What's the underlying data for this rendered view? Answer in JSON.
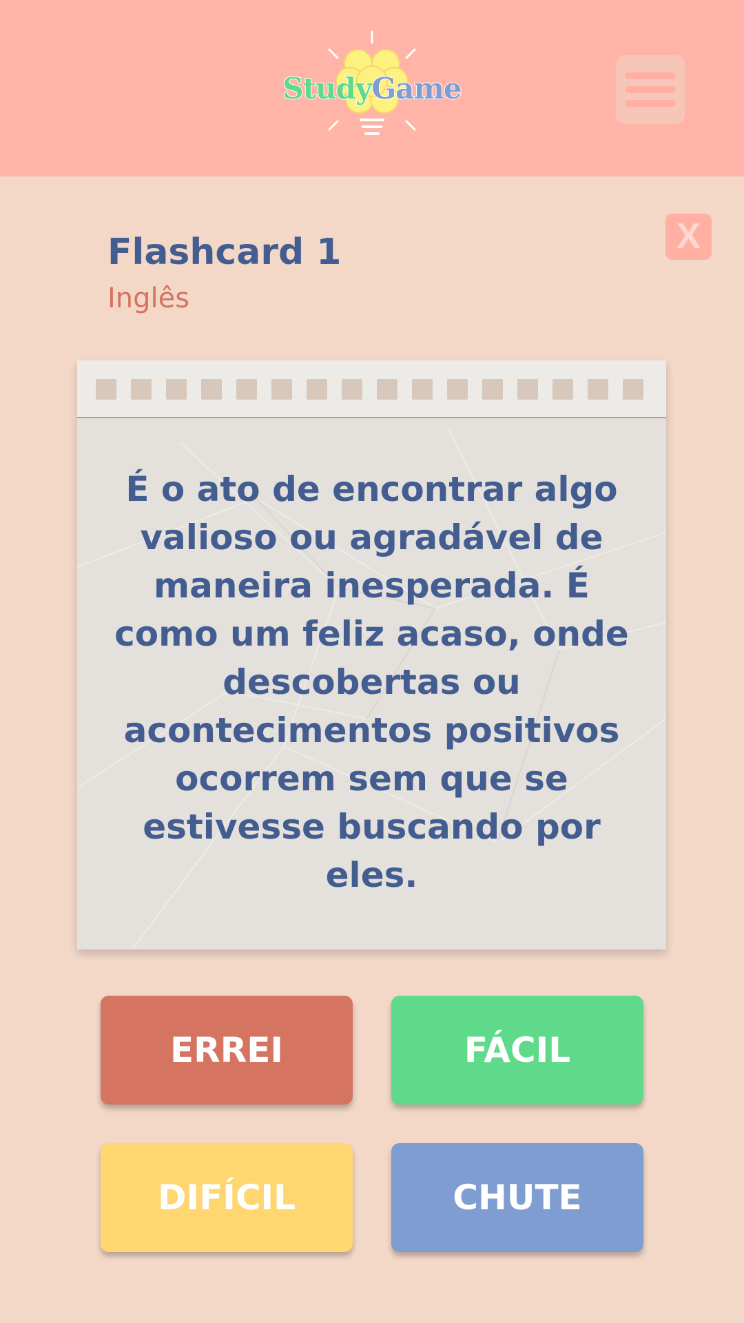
{
  "header": {
    "logo": {
      "word1": "Study",
      "word2": "Game",
      "icon": "brain-lightbulb-icon"
    },
    "menu_icon": "hamburger-menu-icon"
  },
  "flashcard": {
    "title": "Flashcard 1",
    "subject": "Inglês",
    "text": "É o ato de encontrar algo valioso ou agradável de maneira inesperada. É como um feliz acaso, onde descobertas ou acontecimentos positivos ocorrem sem que se estivesse buscando por eles.",
    "close_label": "X"
  },
  "buttons": {
    "errei": "ERREI",
    "facil": "FÁCIL",
    "dificil": "DIFÍCIL",
    "chute": "CHUTE"
  },
  "colors": {
    "background": "#f3d8c8",
    "header": "#ffb4a7",
    "title": "#435d90",
    "subject": "#d67462",
    "errei": "#d67462",
    "facil": "#5fd98a",
    "dificil": "#ffd670",
    "chute": "#7f9dd0"
  }
}
